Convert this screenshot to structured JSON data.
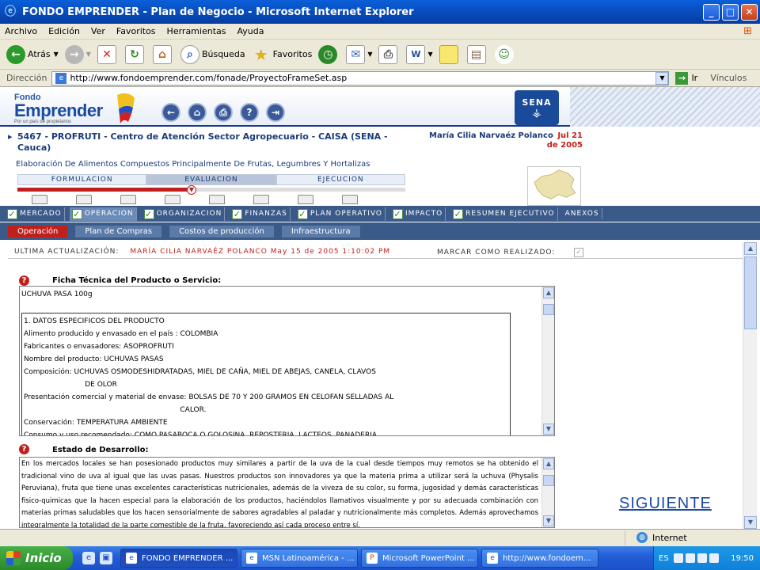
{
  "window": {
    "title": "FONDO EMPRENDER - Plan de Negocio - Microsoft Internet Explorer"
  },
  "menu": [
    "Archivo",
    "Edición",
    "Ver",
    "Favoritos",
    "Herramientas",
    "Ayuda"
  ],
  "toolbar": {
    "back": "Atrás",
    "search": "Búsqueda",
    "favorites": "Favoritos"
  },
  "address": {
    "label": "Dirección",
    "url": "http://www.fondoemprender.com/fonade/ProyectoFrameSet.asp",
    "go": "Ir",
    "links": "Vínculos"
  },
  "site": {
    "logo_top": "Fondo",
    "logo_main": "Emprender",
    "logo_sub": "Por un país de propietarios",
    "sena": "SENA"
  },
  "project": {
    "title": "5467 - PROFRUTI - Centro de Atención Sector Agropecuario - CAISA (SENA - Cauca)",
    "user": "María Cilia Narvaéz Polanco",
    "date": "Jul 21 de 2005",
    "subtitle": "Elaboración De Alimentos Compuestos Principalmente De Frutas, Legumbres Y Hortalizas"
  },
  "phases": [
    "FORMULACION",
    "EVALUACION",
    "EJECUCION"
  ],
  "progress": 0.44,
  "main_tabs": [
    "MERCADO",
    "OPERACION",
    "ORGANIZACION",
    "FINANZAS",
    "PLAN OPERATIVO",
    "IMPACTO",
    "RESUMEN EJECUTIVO",
    "ANEXOS"
  ],
  "sub_tabs": [
    "Operación",
    "Plan de Compras",
    "Costos de producción",
    "Infraestructura"
  ],
  "update": {
    "label": "ULTIMA ACTUALIZACIÓN:",
    "value": "MARÍA CILIA NARVAÉZ POLANCO  May 15 de 2005 1:10:02 PM",
    "mark": "MARCAR COMO REALIZADO:"
  },
  "ficha": {
    "title": "Ficha Técnica del Producto o Servicio:",
    "header": "UCHUVA PASA 100g",
    "lines": [
      "1. DATOS ESPECIFICOS DEL PRODUCTO",
      "Alimento producido y envasado en el país :  COLOMBIA",
      "Fabricantes o envasadores: ASOPROFRUTI",
      "Nombre del producto: UCHUVAS PASAS",
      "Composición: UCHUVAS OSMODESHIDRATADAS, MIEL DE CAÑA, MIEL DE ABEJAS, CANELA, CLAVOS",
      "                           DE OLOR",
      "Presentación comercial y material de envase: BOLSAS DE 70 Y 200 GRAMOS EN CELOFAN SELLADAS AL",
      "                                                                     CALOR.",
      "Conservación:  TEMPERATURA AMBIENTE",
      "Consumo y uso recomendado: COMO PASABOCA O GOLOSINA, REPOSTERIA, LACTEOS, PANADERIA"
    ]
  },
  "estado": {
    "title": "Estado de Desarrollo:",
    "text": "En los mercados locales se han posesionado productos muy similares a partir de la uva de la cual desde tiempos muy remotos se ha obtenido el tradicional vino de uva al igual que las uvas pasas.  Nuestros productos son innovadores ya que la materia prima a utilizar será la uchuva (Physalis Peruviana), fruta que tiene unas excelentes características nutricionales, además de la viveza de su color, su forma, jugosidad y demás características fisico-quimicas que la hacen especial para la elaboración de los productos, haciéndolos llamativos visualmente y por su adecuada combinación con materias primas saludables que los hacen sensorialmente de sabores agradables al paladar y nutricionalmente más completos.  Además aprovechamos integralmente la totalidad de la parte comestible de la fruta, favoreciendo así cada proceso entre sí."
  },
  "next": "SIGUIENTE",
  "status": {
    "zone": "Internet"
  },
  "taskbar": {
    "start": "Inicio",
    "tasks": [
      "FONDO EMPRENDER ...",
      "MSN Latinoamérica - ...",
      "Microsoft PowerPoint ...",
      "http://www.fondoem..."
    ],
    "lang": "ES",
    "clock": "19:50"
  }
}
